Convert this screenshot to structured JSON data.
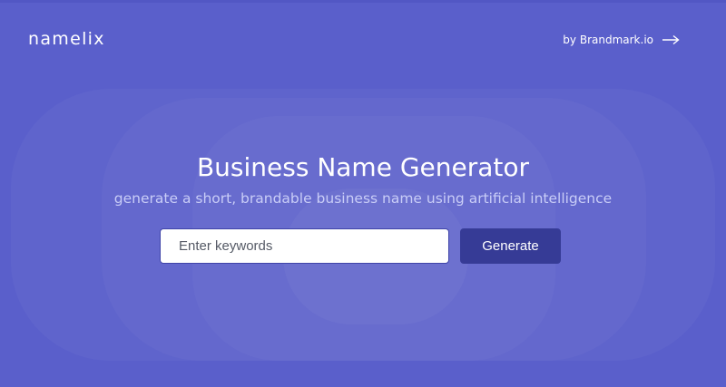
{
  "header": {
    "logo_text": "namelix",
    "by_link_label": "by Brandmark.io",
    "by_link_icon": "arrow-right-icon"
  },
  "hero": {
    "title": "Business Name Generator",
    "subtitle": "generate a short, brandable business name using artificial intelligence"
  },
  "search": {
    "value": "",
    "placeholder": "Enter keywords"
  },
  "actions": {
    "generate_label": "Generate"
  },
  "colors": {
    "background": "#5a5fcb",
    "button": "#363b96",
    "subtitle": "#c9cdf7",
    "input_border": "#3f44a8"
  }
}
